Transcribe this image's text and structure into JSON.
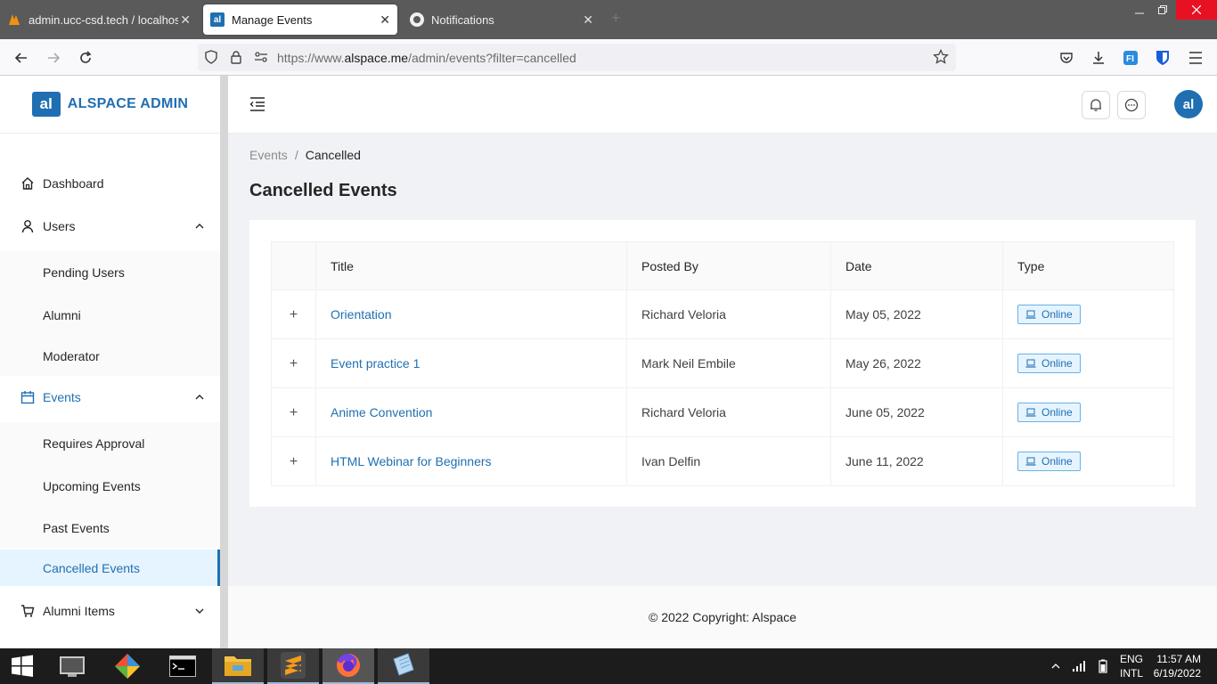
{
  "browser": {
    "tabs": [
      {
        "title": "admin.ucc-csd.tech / localhost",
        "active": false
      },
      {
        "title": "Manage Events",
        "active": true
      },
      {
        "title": "Notifications",
        "active": false
      }
    ],
    "close_glyph": "✕",
    "new_tab_glyph": "+",
    "url": {
      "prefix": "https://www.",
      "host": "alspace.me",
      "path": "/admin/events?filter=cancelled"
    }
  },
  "app": {
    "logo_text": "al",
    "brand_name": "ALSPACE ADMIN",
    "avatar_text": "al"
  },
  "sidebar": {
    "items": [
      {
        "label": "Dashboard"
      },
      {
        "label": "Users"
      },
      {
        "label": "Pending Users"
      },
      {
        "label": "Alumni"
      },
      {
        "label": "Moderator"
      },
      {
        "label": "Events"
      },
      {
        "label": "Requires Approval"
      },
      {
        "label": "Upcoming Events"
      },
      {
        "label": "Past Events"
      },
      {
        "label": "Cancelled Events"
      },
      {
        "label": "Alumni Items"
      }
    ]
  },
  "breadcrumb": {
    "root": "Events",
    "separator": "/",
    "current": "Cancelled"
  },
  "page_title": "Cancelled Events",
  "table": {
    "columns": [
      "Title",
      "Posted By",
      "Date",
      "Type"
    ],
    "rows": [
      {
        "title": "Orientation",
        "posted_by": "Richard Veloria",
        "date": "May 05, 2022",
        "type": "Online"
      },
      {
        "title": "Event practice 1",
        "posted_by": "Mark Neil Embile",
        "date": "May 26, 2022",
        "type": "Online"
      },
      {
        "title": "Anime Convention",
        "posted_by": "Richard Veloria",
        "date": "June 05, 2022",
        "type": "Online"
      },
      {
        "title": "HTML Webinar for Beginners",
        "posted_by": "Ivan Delfin",
        "date": "June 11, 2022",
        "type": "Online"
      }
    ]
  },
  "footer": "© 2022 Copyright: Alspace",
  "taskbar": {
    "lang_line1": "ENG",
    "lang_line2": "INTL",
    "time": "11:57 AM",
    "date": "6/19/2022"
  },
  "colors": {
    "accent": "#1f6fb2",
    "tag_bg": "#e6f4ff",
    "content_bg": "#f0f2f5"
  }
}
